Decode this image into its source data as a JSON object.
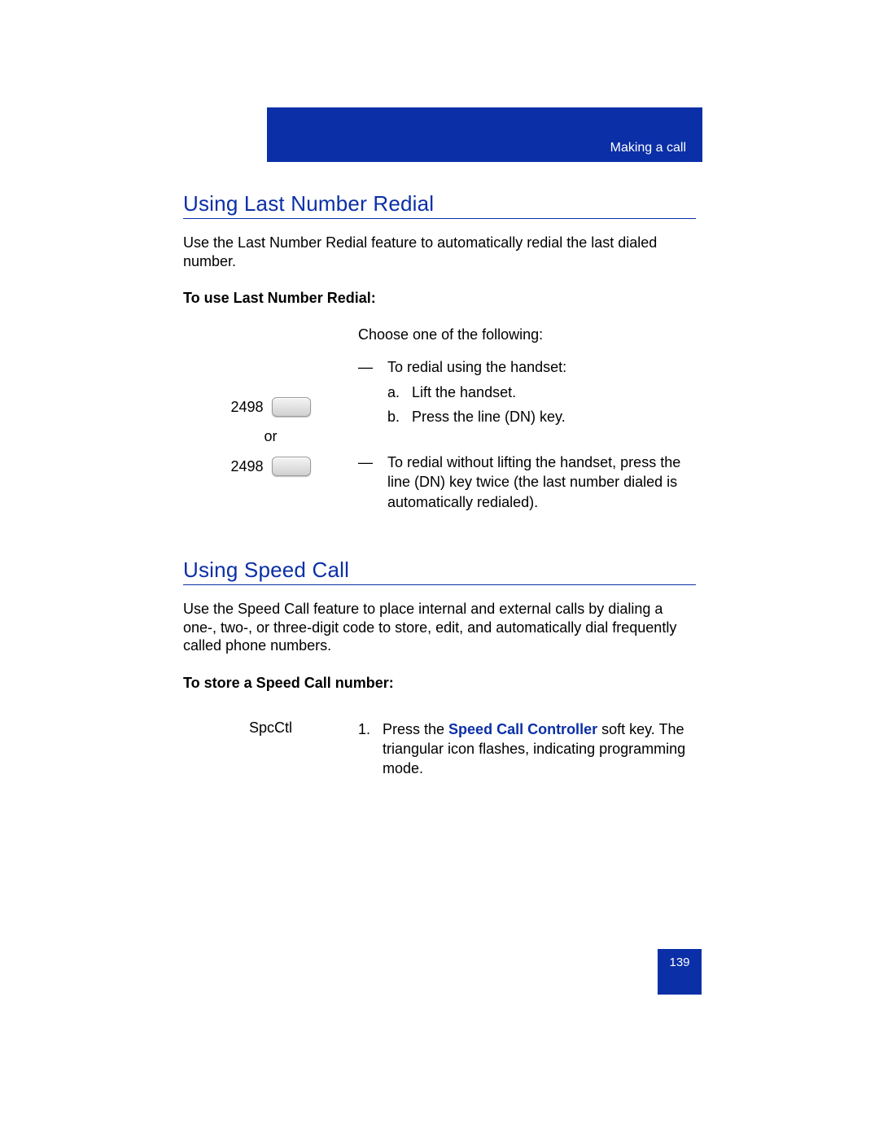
{
  "header": {
    "breadcrumb": "Making a call"
  },
  "section1": {
    "title": "Using Last Number Redial",
    "intro": "Use the Last Number Redial feature to automatically redial the last dialed number.",
    "subhead": "To use Last Number Redial:",
    "left": {
      "key1": "2498",
      "or": "or",
      "key2": "2498"
    },
    "right": {
      "choose": "Choose one of the following:",
      "dash1": "To redial using the handset:",
      "a_marker": "a.",
      "a_text": "Lift the handset.",
      "b_marker": "b.",
      "b_text": "Press the line (DN) key.",
      "dash2": "To redial without lifting the handset, press the line (DN) key twice (the last number dialed is automatically redialed)."
    }
  },
  "section2": {
    "title": "Using Speed Call",
    "intro": "Use the Speed Call feature to place internal and external calls by dialing a one-, two-, or three-digit code to store, edit, and automatically dial frequently called phone numbers.",
    "subhead": "To store a Speed Call number:",
    "left": "SpcCtl",
    "right": {
      "num_marker": "1.",
      "pre": "Press the ",
      "bold": "Speed Call Controller",
      "post": " soft key. The triangular icon flashes, indicating programming mode."
    }
  },
  "page_number": "139",
  "dash": "—"
}
